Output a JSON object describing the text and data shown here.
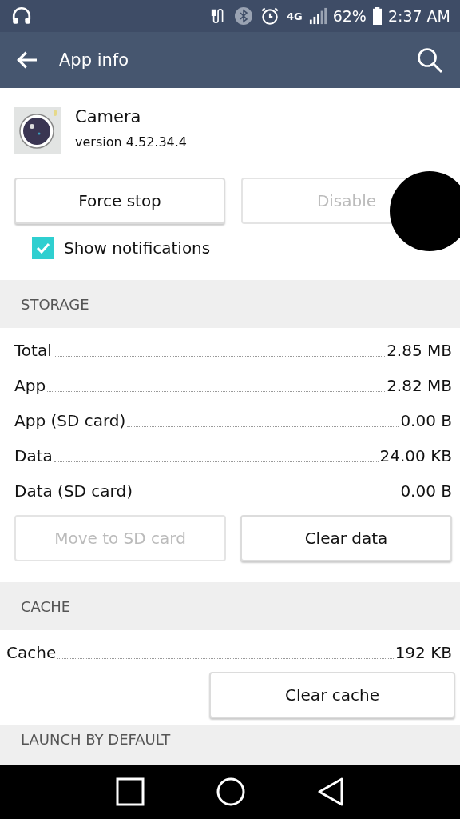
{
  "status_bar": {
    "network_type": "4G",
    "battery": "62%",
    "time": "2:37 AM"
  },
  "app_bar": {
    "title": "App info"
  },
  "app": {
    "name": "Camera",
    "version": "version 4.52.34.4"
  },
  "app_buttons": [
    {
      "label": "Force stop",
      "disabled": false
    },
    {
      "label": "Disable",
      "disabled": true
    }
  ],
  "show_notifications": {
    "label": "Show notifications",
    "checked": true
  },
  "storage": {
    "header": "STORAGE",
    "rows": [
      {
        "label": "Total",
        "value": "2.85 MB"
      },
      {
        "label": "App",
        "value": "2.82 MB"
      },
      {
        "label": "App (SD card)",
        "value": "0.00 B"
      },
      {
        "label": "Data",
        "value": "24.00 KB"
      },
      {
        "label": "Data (SD card)",
        "value": "0.00 B"
      }
    ],
    "buttons": [
      {
        "label": "Move to SD card",
        "disabled": true
      },
      {
        "label": "Clear data",
        "disabled": false
      }
    ]
  },
  "cache": {
    "header": "CACHE",
    "rows": [
      {
        "label": "Cache",
        "value": "192 KB"
      }
    ],
    "buttons": [
      {
        "label": "Clear cache",
        "disabled": false
      }
    ]
  },
  "next_section": {
    "header": "LAUNCH BY DEFAULT"
  }
}
